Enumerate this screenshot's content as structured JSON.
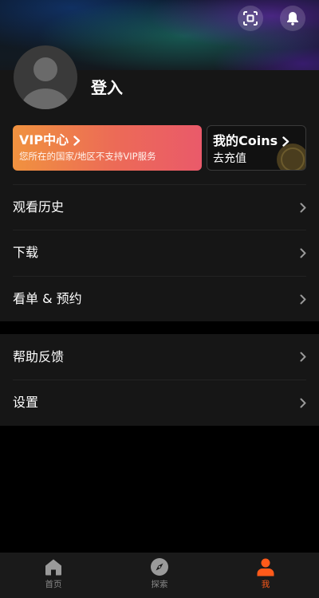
{
  "profile": {
    "login_label": "登入"
  },
  "vip_card": {
    "title": "VIP中心",
    "subtitle": "您所在的国家/地区不支持VIP服务"
  },
  "coins_card": {
    "title": "我的Coins",
    "action": "去充值"
  },
  "menu_group_1": [
    {
      "label": "观看历史"
    },
    {
      "label": "下载"
    },
    {
      "label": "看单 & 预约"
    }
  ],
  "menu_group_2": [
    {
      "label": "帮助反馈"
    },
    {
      "label": "设置"
    }
  ],
  "bottom_nav": [
    {
      "label": "首页",
      "icon": "home-icon",
      "active": false
    },
    {
      "label": "探索",
      "icon": "compass-icon",
      "active": false
    },
    {
      "label": "我",
      "icon": "person-icon",
      "active": true
    }
  ],
  "colors": {
    "accent": "#ff5a1a",
    "vip_gradient_start": "#f0923f",
    "vip_gradient_end": "#ea5a6a"
  }
}
